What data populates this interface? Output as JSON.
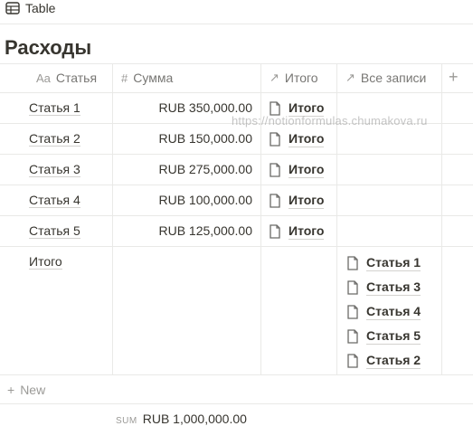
{
  "view_tab": {
    "label": "Table",
    "icon": "table-icon"
  },
  "page_title": "Расходы",
  "columns": [
    {
      "name": "Статья",
      "icon_text": "Aa"
    },
    {
      "name": "Сумма",
      "icon_text": "#"
    },
    {
      "name": "Итого",
      "icon_text": "↗"
    },
    {
      "name": "Все записи",
      "icon_text": "↗"
    }
  ],
  "add_column_symbol": "+",
  "rows": [
    {
      "name": "Статья 1",
      "amount": "RUB 350,000.00",
      "total": "Итого"
    },
    {
      "name": "Статья 2",
      "amount": "RUB 150,000.00",
      "total": "Итого"
    },
    {
      "name": "Статья 3",
      "amount": "RUB 275,000.00",
      "total": "Итого"
    },
    {
      "name": "Статья 4",
      "amount": "RUB 100,000.00",
      "total": "Итого"
    },
    {
      "name": "Статья 5",
      "amount": "RUB 125,000.00",
      "total": "Итого"
    }
  ],
  "summary_row": {
    "name": "Итого",
    "all_records": [
      "Статья 1",
      "Статья 3",
      "Статья 4",
      "Статья 5",
      "Статья 2"
    ]
  },
  "watermark": "https://notionformulas.chumakova.ru",
  "new_row_label": "New",
  "sum_footer": {
    "label": "SUM",
    "value": "RUB 1,000,000.00"
  }
}
